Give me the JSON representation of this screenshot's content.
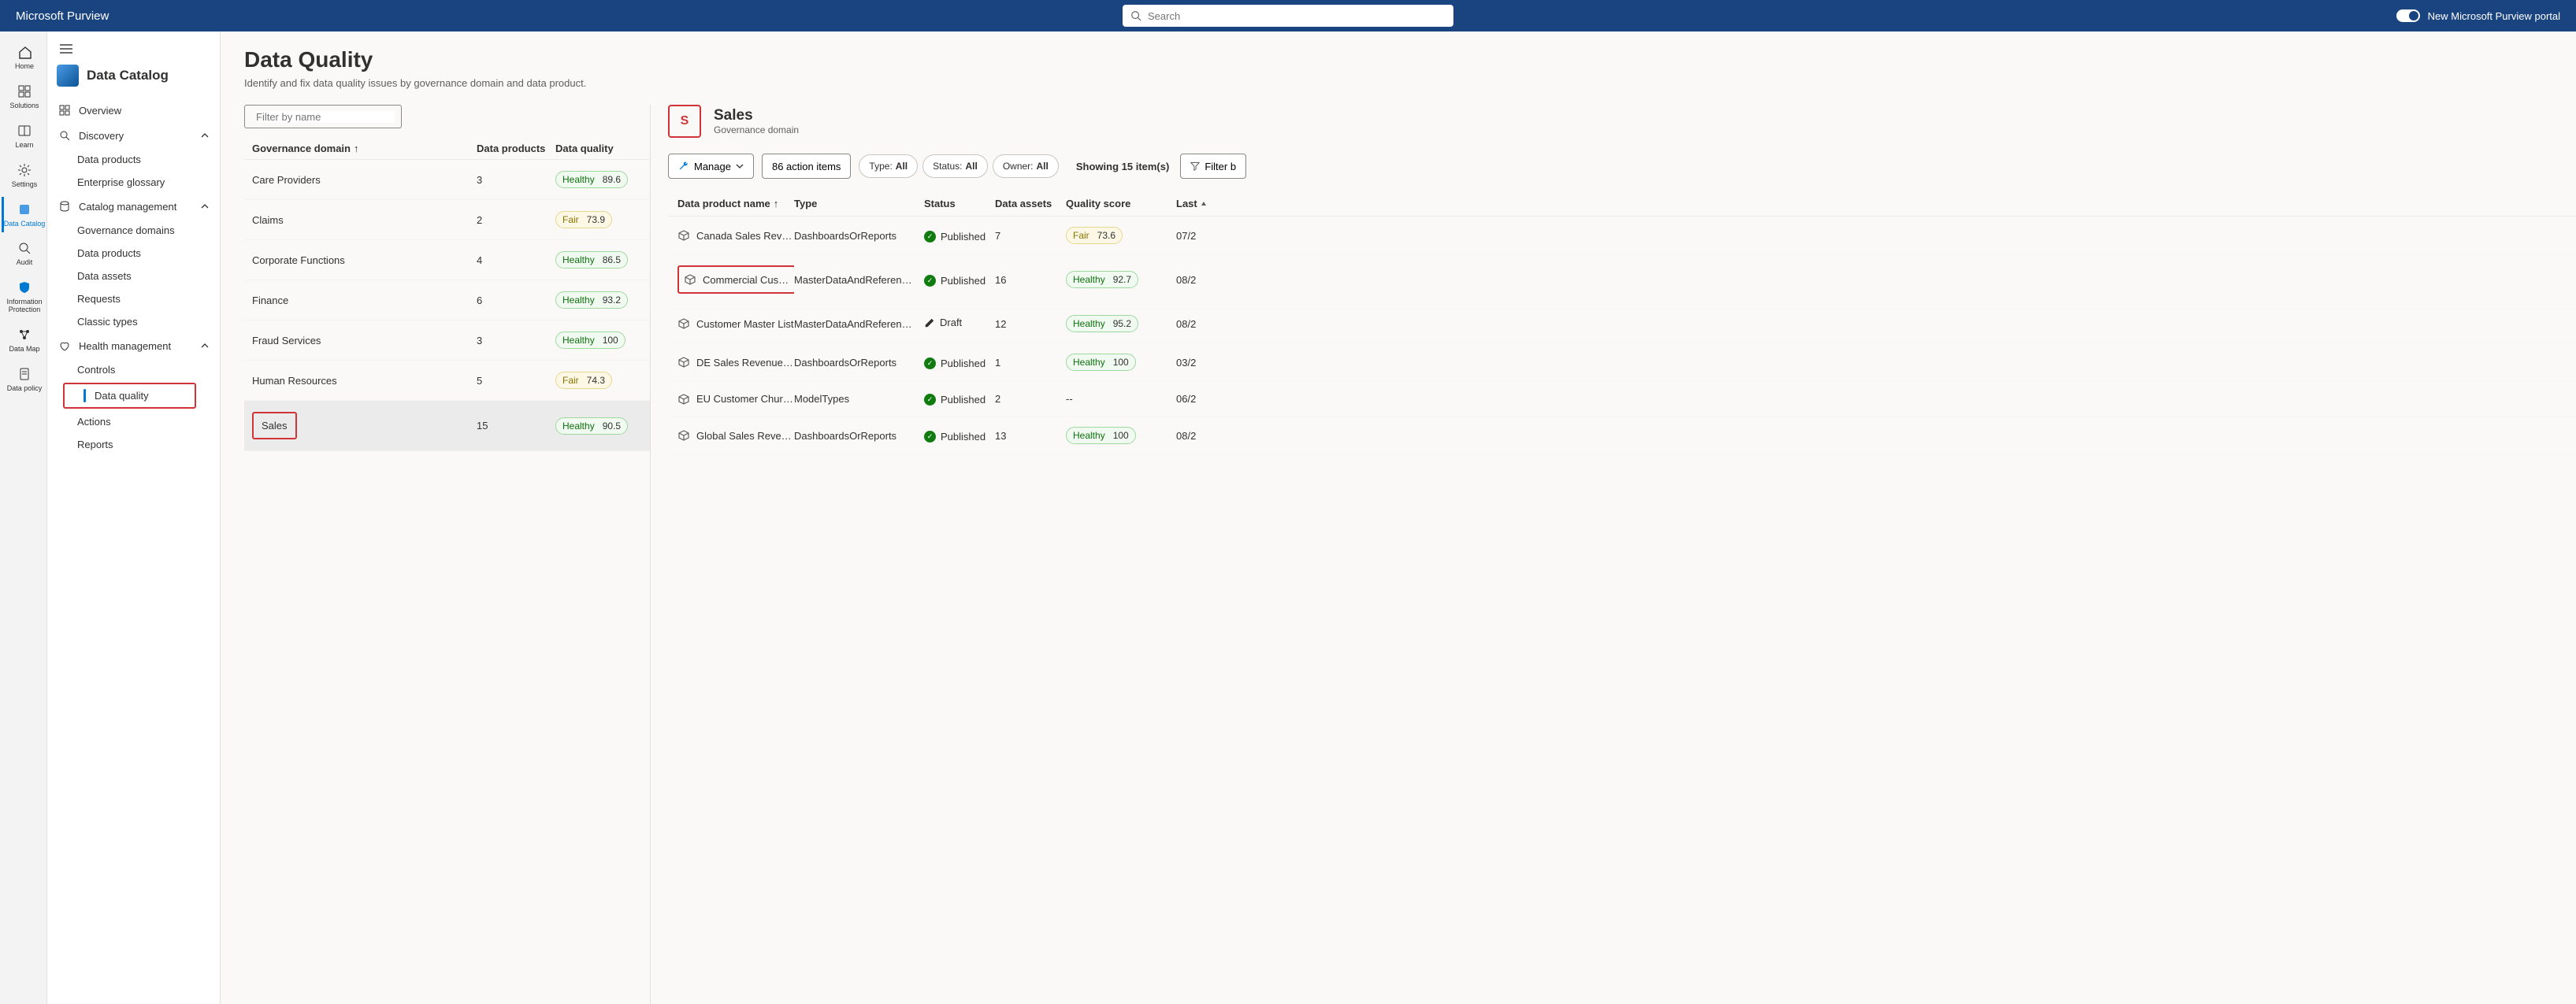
{
  "brand": "Microsoft Purview",
  "search_placeholder": "Search",
  "portal_toggle_label": "New Microsoft Purview portal",
  "rail": [
    {
      "label": "Home"
    },
    {
      "label": "Solutions"
    },
    {
      "label": "Learn"
    },
    {
      "label": "Settings"
    },
    {
      "label": "Data Catalog",
      "active": true
    },
    {
      "label": "Audit"
    },
    {
      "label": "Information Protection",
      "multi": true
    },
    {
      "label": "Data Map"
    },
    {
      "label": "Data policy"
    }
  ],
  "sidebar": {
    "title": "Data Catalog",
    "items": [
      {
        "label": "Overview",
        "icon": "grid"
      },
      {
        "label": "Discovery",
        "icon": "search",
        "expandable": true,
        "expanded": true,
        "children": [
          {
            "label": "Data products"
          },
          {
            "label": "Enterprise glossary"
          }
        ]
      },
      {
        "label": "Catalog management",
        "icon": "db",
        "expandable": true,
        "expanded": true,
        "children": [
          {
            "label": "Governance domains"
          },
          {
            "label": "Data products"
          },
          {
            "label": "Data assets"
          },
          {
            "label": "Requests"
          },
          {
            "label": "Classic types"
          }
        ]
      },
      {
        "label": "Health management",
        "icon": "heart",
        "expandable": true,
        "expanded": true,
        "children": [
          {
            "label": "Controls"
          },
          {
            "label": "Data quality",
            "highlight": true,
            "red": true
          },
          {
            "label": "Actions"
          },
          {
            "label": "Reports"
          }
        ]
      }
    ]
  },
  "page": {
    "title": "Data Quality",
    "subtitle": "Identify and fix data quality issues by governance domain and data product."
  },
  "filter_placeholder": "Filter by name",
  "domain_columns": {
    "name": "Governance domain",
    "products": "Data products",
    "quality": "Data quality"
  },
  "domains": [
    {
      "name": "Care Providers",
      "products": "3",
      "quality": "Healthy",
      "score": "89.6"
    },
    {
      "name": "Claims",
      "products": "2",
      "quality": "Fair",
      "score": "73.9"
    },
    {
      "name": "Corporate Functions",
      "products": "4",
      "quality": "Healthy",
      "score": "86.5"
    },
    {
      "name": "Finance",
      "products": "6",
      "quality": "Healthy",
      "score": "93.2"
    },
    {
      "name": "Fraud Services",
      "products": "3",
      "quality": "Healthy",
      "score": "100"
    },
    {
      "name": "Human Resources",
      "products": "5",
      "quality": "Fair",
      "score": "74.3"
    },
    {
      "name": "Sales",
      "products": "15",
      "quality": "Healthy",
      "score": "90.5",
      "selected": true,
      "red": true
    }
  ],
  "detail": {
    "initial": "S",
    "title": "Sales",
    "subtitle": "Governance domain",
    "manage_label": "Manage",
    "action_items_label": "86 action items",
    "pills": [
      {
        "prefix": "Type:",
        "value": "All"
      },
      {
        "prefix": "Status:",
        "value": "All"
      },
      {
        "prefix": "Owner:",
        "value": "All"
      }
    ],
    "showing": "Showing 15 item(s)",
    "filter_button": "Filter b",
    "columns": {
      "name": "Data product name",
      "type": "Type",
      "status": "Status",
      "assets": "Data assets",
      "score": "Quality score",
      "last": "Last"
    },
    "rows": [
      {
        "name": "Canada Sales Reven…",
        "type": "DashboardsOrReports",
        "status": "Published",
        "assets": "7",
        "quality": "Fair",
        "score": "73.6",
        "last": "07/2"
      },
      {
        "name": "Commercial Custom…",
        "type": "MasterDataAndReferen…",
        "status": "Published",
        "assets": "16",
        "quality": "Healthy",
        "score": "92.7",
        "last": "08/2",
        "red": true
      },
      {
        "name": "Customer Master List",
        "type": "MasterDataAndReferen…",
        "status": "Draft",
        "assets": "12",
        "quality": "Healthy",
        "score": "95.2",
        "last": "08/2"
      },
      {
        "name": "DE Sales Revenue In…",
        "type": "DashboardsOrReports",
        "status": "Published",
        "assets": "1",
        "quality": "Healthy",
        "score": "100",
        "last": "03/2"
      },
      {
        "name": "EU Customer Churn …",
        "type": "ModelTypes",
        "status": "Published",
        "assets": "2",
        "quality": "none",
        "score": "--",
        "last": "06/2"
      },
      {
        "name": "Global Sales Revenu…",
        "type": "DashboardsOrReports",
        "status": "Published",
        "assets": "13",
        "quality": "Healthy",
        "score": "100",
        "last": "08/2"
      }
    ]
  }
}
